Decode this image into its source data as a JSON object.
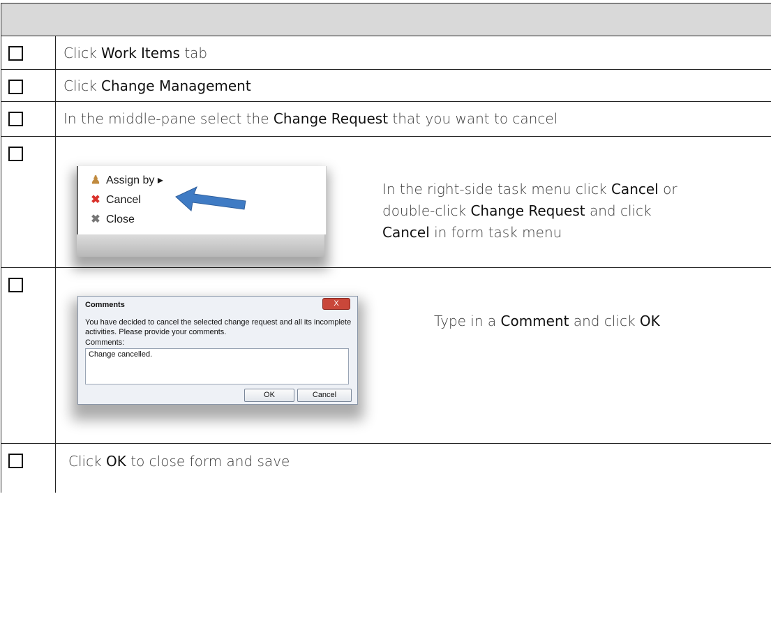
{
  "steps": [
    {
      "pre": "Click ",
      "bold": "Work Items",
      "post": " tab"
    },
    {
      "pre": "Click ",
      "bold": "Change Management",
      "post": ""
    },
    {
      "pre": "In the middle-pane select the ",
      "bold": "Change Request",
      "post": " that you want to cancel"
    },
    {
      "lines": [
        {
          "pre": "In the right-side task menu click ",
          "bold": "Cancel",
          "post": " or"
        },
        {
          "pre": "double-click ",
          "bold": "Change Request",
          "post": " and click"
        },
        {
          "pre": "",
          "bold": "Cancel",
          "post": " in form task menu"
        }
      ]
    },
    {
      "pre": "Type in a ",
      "bold": "Comment",
      "post": " and click ",
      "bold2": "OK"
    },
    {
      "pre": "Click ",
      "bold": "OK",
      "post": " to close form and save"
    }
  ],
  "menu": {
    "items": [
      {
        "icon": "user-icon",
        "label": "Assign by ▸"
      },
      {
        "icon": "x-red-icon",
        "label": "Cancel"
      },
      {
        "icon": "x-gray-icon",
        "label": "Close"
      }
    ]
  },
  "dialog": {
    "title": "Comments",
    "close": "X",
    "message": "You have decided to cancel the selected change request and all its incomplete activities. Please provide your comments.",
    "label": "Comments:",
    "value": "Change cancelled.",
    "ok": "OK",
    "cancel": "Cancel"
  },
  "colors": {
    "header_bg": "#d9d9d9",
    "arrow": "#3f7bc4",
    "cancel_icon": "#d9312b"
  }
}
